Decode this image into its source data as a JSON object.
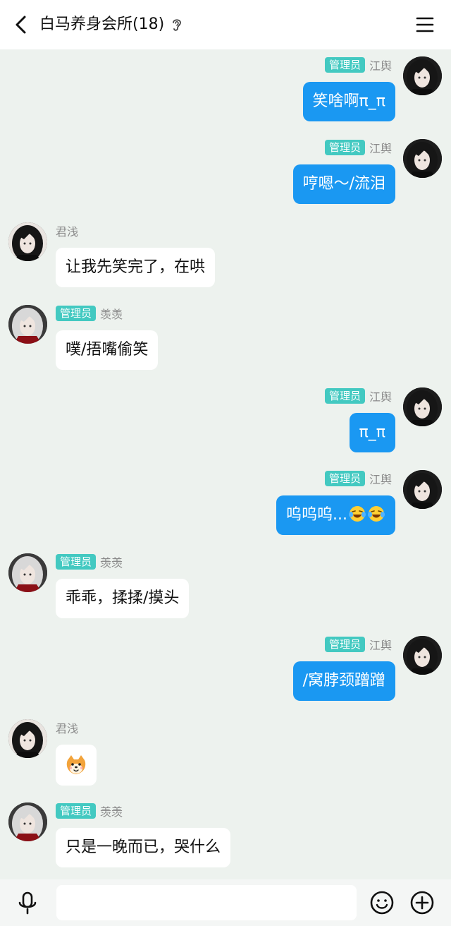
{
  "header": {
    "back_icon": "chevron-left-icon",
    "title": "白马养身会所(18)",
    "ear_icon": "ear-icon",
    "menu_icon": "hamburger-menu-icon"
  },
  "colors": {
    "my_bubble": "#1a98f2",
    "their_bubble": "#ffffff",
    "admin_badge": "#43c9c1",
    "chat_background": "#edf2ee"
  },
  "messages": [
    {
      "side": "me",
      "badge": "管理员",
      "sender": "江舆",
      "text": "笑啥啊π_π"
    },
    {
      "side": "me",
      "badge": "管理员",
      "sender": "江舆",
      "text": "哼嗯～/流泪"
    },
    {
      "side": "them",
      "badge": "",
      "sender": "君浅",
      "text": "让我先笑完了，在哄"
    },
    {
      "side": "them",
      "badge": "管理员",
      "sender": "羡羡",
      "text": "噗/捂嘴偷笑"
    },
    {
      "side": "me",
      "badge": "管理员",
      "sender": "江舆",
      "text": "π_π"
    },
    {
      "side": "me",
      "badge": "管理员",
      "sender": "江舆",
      "text": "呜呜呜...",
      "emojis": [
        "crying-laughing-emoji",
        "crying-laughing-emoji"
      ]
    },
    {
      "side": "them",
      "badge": "管理员",
      "sender": "羡羡",
      "text": "乖乖，揉揉/摸头"
    },
    {
      "side": "me",
      "badge": "管理员",
      "sender": "江舆",
      "text": "/窝脖颈蹭蹭"
    },
    {
      "side": "them",
      "badge": "",
      "sender": "君浅",
      "text": "",
      "sticker": "shiba-dog-emoji"
    },
    {
      "side": "them",
      "badge": "管理员",
      "sender": "羡羡",
      "text": "只是一晚而已，哭什么"
    }
  ],
  "footer": {
    "mic_icon": "microphone-icon",
    "input_value": "",
    "emoji_icon": "smiley-icon",
    "plus_icon": "plus-circle-icon"
  }
}
